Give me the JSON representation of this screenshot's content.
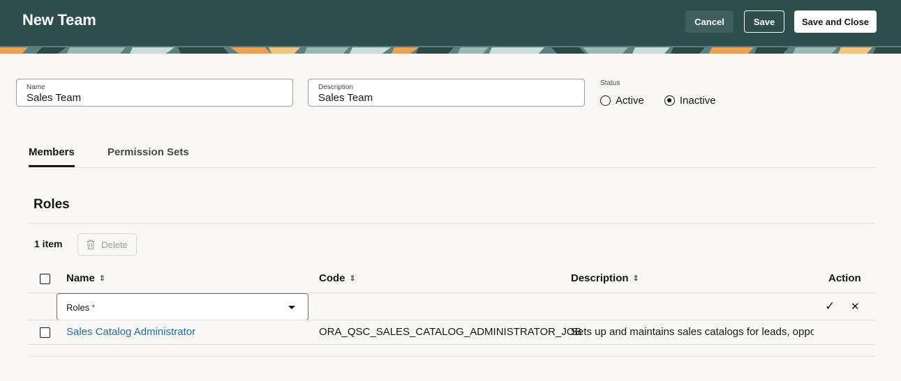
{
  "header": {
    "title": "New Team",
    "cancel_label": "Cancel",
    "save_label": "Save",
    "save_close_label": "Save and Close",
    "background_color": "#2e4d4d"
  },
  "form": {
    "name": {
      "label": "Name",
      "value": "Sales Team"
    },
    "description": {
      "label": "Description",
      "value": "Sales Team"
    },
    "status": {
      "label": "Status",
      "options": [
        "Active",
        "Inactive"
      ],
      "selected": "Inactive"
    }
  },
  "tabs": [
    {
      "label": "Members",
      "active": true
    },
    {
      "label": "Permission Sets",
      "active": false
    }
  ],
  "roles": {
    "heading": "Roles",
    "count_label": "1 item",
    "delete_label": "Delete",
    "columns": {
      "name": "Name",
      "code": "Code",
      "description": "Description",
      "action": "Action"
    },
    "new_row": {
      "select_label": "Roles",
      "required_marker": "*"
    },
    "rows": [
      {
        "name": "Sales Catalog Administrator",
        "code": "ORA_QSC_SALES_CATALOG_ADMINISTRATOR_JOB",
        "description": "Sets up and maintains sales catalogs for leads, opportu"
      }
    ]
  },
  "icons": {
    "sort": "⇕",
    "confirm": "✓",
    "cancel": "✕"
  }
}
